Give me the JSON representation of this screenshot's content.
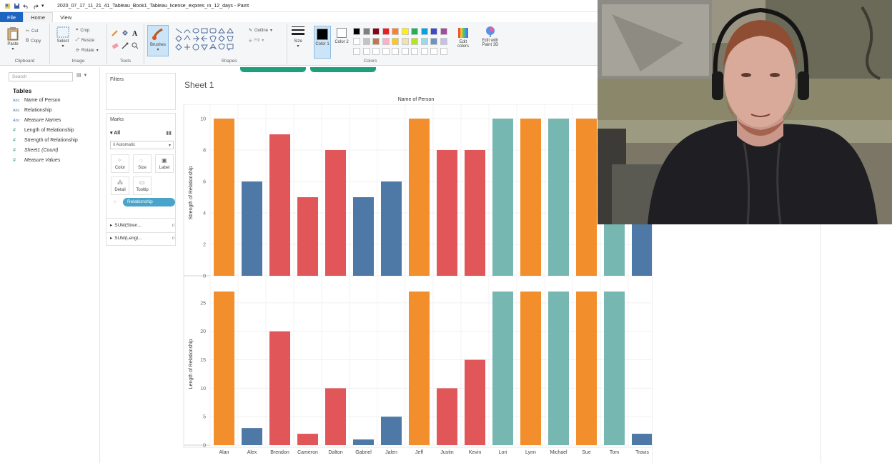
{
  "window": {
    "title": "2020_07_17_11_21_41_Tableau_Book1_Tableau_license_expires_in_12_days - Paint",
    "quick_access_more": "▾"
  },
  "ribbon": {
    "tabs": [
      "File",
      "Home",
      "View"
    ],
    "clipboard": {
      "paste": "Paste",
      "cut": "Cut",
      "copy": "Copy",
      "group": "Clipboard"
    },
    "image": {
      "select": "Select",
      "crop": "Crop",
      "resize": "Resize",
      "rotate": "Rotate",
      "group": "Image"
    },
    "tools": {
      "group": "Tools"
    },
    "brushes": {
      "label": "Brushes"
    },
    "shapes": {
      "outline": "Outline",
      "fill": "Fill",
      "group": "Shapes"
    },
    "size": {
      "label": "Size"
    },
    "colors": {
      "color1": "Color 1",
      "color2": "Color 2",
      "edit_colors": "Edit colors",
      "edit_with_paint3d": "Edit with Paint 3D",
      "group": "Colors",
      "palette_row1": [
        "#000000",
        "#7f7f7f",
        "#880015",
        "#ed1c24",
        "#ff7f27",
        "#fff200",
        "#22b14c",
        "#00a2e8",
        "#3f48cc",
        "#a349a4"
      ],
      "palette_row2": [
        "#ffffff",
        "#c3c3c3",
        "#b97a57",
        "#ffaec9",
        "#ffc90e",
        "#efe4b0",
        "#b5e61d",
        "#99d9ea",
        "#7092be",
        "#c8bfe7"
      ]
    }
  },
  "data_pane": {
    "search_placeholder": "Search",
    "tables_title": "Tables",
    "fields": [
      {
        "icon": "Abc",
        "name": "Name of Person",
        "kind": "dimension"
      },
      {
        "icon": "Abc",
        "name": "Relationship",
        "kind": "dimension"
      },
      {
        "icon": "Abc",
        "name": "Measure Names",
        "kind": "dimension"
      },
      {
        "icon": "#",
        "name": "Length of Relationship",
        "kind": "measure"
      },
      {
        "icon": "#",
        "name": "Strength of Relationship",
        "kind": "measure"
      },
      {
        "icon": "#",
        "name": "Sheet1 (Count)",
        "kind": "measure"
      },
      {
        "icon": "#",
        "name": "Measure Values",
        "kind": "measure"
      }
    ]
  },
  "shelves": {
    "filters": "Filters",
    "marks": "Marks",
    "all": "All",
    "mark_type": "Automatic",
    "buttons": [
      "Color",
      "Size",
      "Label",
      "Detail",
      "Tooltip"
    ],
    "color_pill": "Relationship",
    "measures": [
      "SUM(Stren...",
      "SUM(Lengt..."
    ]
  },
  "sheet": {
    "title": "Sheet 1",
    "column_header": "Name of Person"
  },
  "chart_data": {
    "type": "bar",
    "categories": [
      "Alan",
      "Alex",
      "Brendon",
      "Cameron",
      "Dalton",
      "Gabriel",
      "Jalen",
      "Jeff",
      "Justin",
      "Kevin",
      "Lori",
      "Lynn",
      "Michael",
      "Sue",
      "Tom",
      "Travis"
    ],
    "colors_hex": {
      "orange": "#f28e2b",
      "blue": "#4e79a7",
      "red": "#e15759",
      "teal": "#76b7b2"
    },
    "bar_colors": [
      "orange",
      "blue",
      "red",
      "red",
      "red",
      "blue",
      "blue",
      "orange",
      "red",
      "red",
      "teal",
      "orange",
      "teal",
      "orange",
      "teal",
      "blue"
    ],
    "panels": [
      {
        "ylabel": "Strength of Relationship",
        "ylim": [
          0,
          10
        ],
        "yticks": [
          0,
          2,
          4,
          6,
          8,
          10
        ],
        "values": [
          10,
          6,
          9,
          5,
          8,
          5,
          6,
          10,
          8,
          8,
          10,
          10,
          10,
          10,
          10,
          8
        ]
      },
      {
        "ylabel": "Length of Relationship",
        "ylim": [
          0,
          27
        ],
        "yticks": [
          0,
          5,
          10,
          15,
          20,
          25
        ],
        "values": [
          27,
          3,
          20,
          2,
          10,
          1,
          5,
          27,
          10,
          15,
          27,
          27,
          27,
          27,
          27,
          2
        ]
      }
    ],
    "grid": true,
    "legend": "none"
  },
  "webcam": {
    "description_hidden": ""
  }
}
